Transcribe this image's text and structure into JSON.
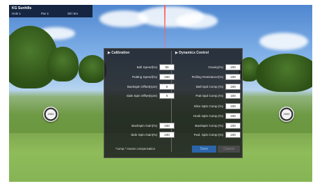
{
  "hud": {
    "course": "KG Sunhills",
    "hole": "Hole 1",
    "par": "Par 4",
    "distance": "367.5m"
  },
  "markers": {
    "left_label": "2000",
    "right_label": "2000"
  },
  "calibration": {
    "title": "▶ Calibration",
    "fields": [
      {
        "label": "Ball Speed(%)",
        "value": "50"
      },
      {
        "label": "Putting Speed(%)",
        "value": "100"
      },
      {
        "label": "Backspin Offset(rpm)",
        "value": "0"
      },
      {
        "label": "Side Spin Offset(rpm)",
        "value": "0"
      },
      {
        "label": "Backspin Gain(%)",
        "value": "100"
      },
      {
        "label": "Side Spin Gain(%)",
        "value": "100"
      }
    ]
  },
  "dynamics": {
    "title": "▶ Dynamics Control",
    "fields": [
      {
        "label": "Gravity(%)",
        "value": "100"
      },
      {
        "label": "Rolling Resistance(%)",
        "value": "100"
      },
      {
        "label": "Ball Spd Comp.(%)",
        "value": "100"
      },
      {
        "label": "Putt Spd Comp.(%)",
        "value": "100"
      },
      {
        "label": "Slice Spin Comp.(%)",
        "value": "100"
      },
      {
        "label": "Hook Spin Comp.(%)",
        "value": "100"
      },
      {
        "label": "Backspin Comp.(%)",
        "value": "100"
      },
      {
        "label": "Fwd. Spin Comp.(%)",
        "value": "100"
      }
    ]
  },
  "note": "*comp.* means compensation",
  "buttons": {
    "save": "Save",
    "cancel": "Cancel"
  }
}
